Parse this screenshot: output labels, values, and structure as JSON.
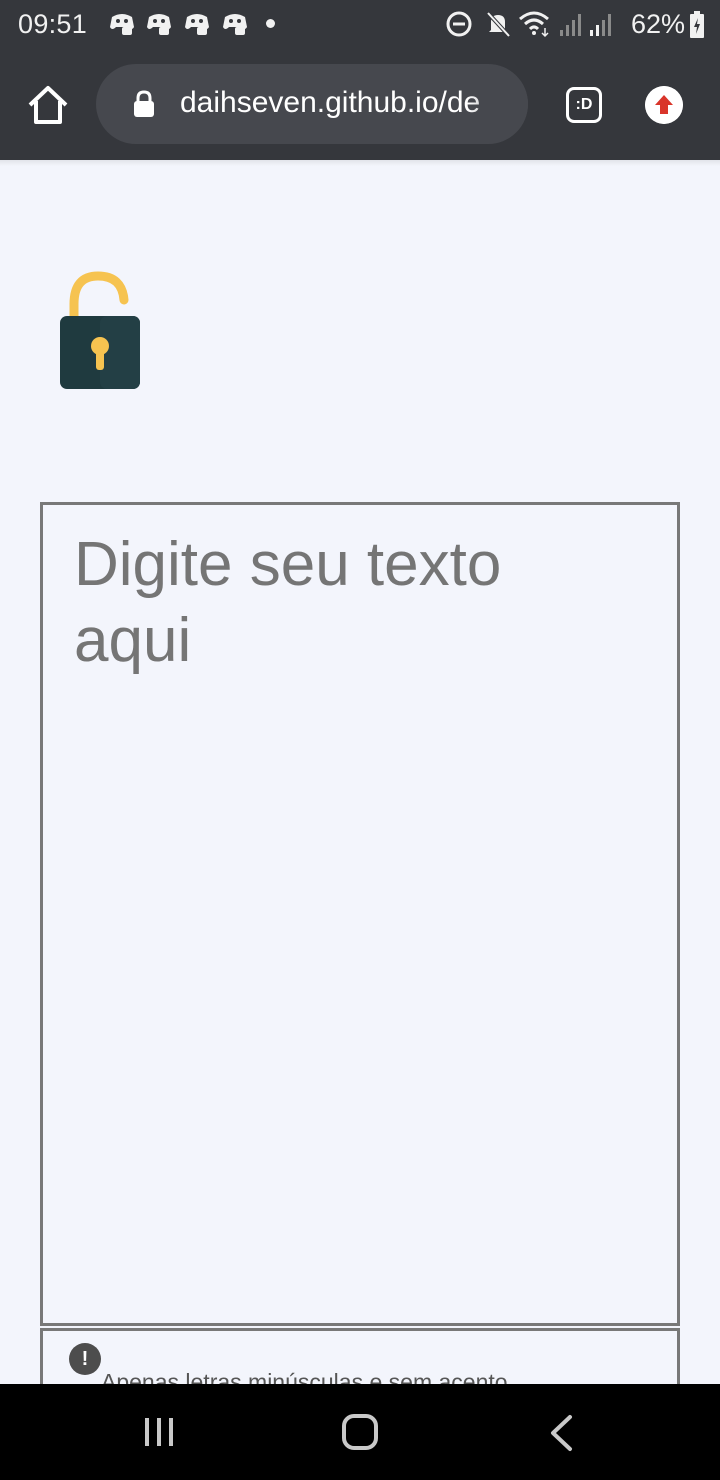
{
  "status_bar": {
    "time": "09:51",
    "battery": "62%",
    "notification_icons": [
      "game-notification-icon",
      "game-notification-icon",
      "game-notification-icon",
      "game-notification-icon"
    ],
    "system_icons": [
      "do-not-disturb-icon",
      "mute-icon",
      "wifi-icon",
      "signal-icon",
      "signal-icon",
      "battery-charging-icon"
    ]
  },
  "browser": {
    "url": "daihseven.github.io/de",
    "tab_label": ":D"
  },
  "page": {
    "textarea_placeholder": "Digite seu texto aqui",
    "hint": "Apenas letras minúsculas e sem acento",
    "hint_icon_glyph": "!"
  },
  "colors": {
    "toolbar": "#35373c",
    "page_background": "#f3f5fc",
    "lock_shackle": "#f6c350",
    "lock_body": "#1f3a3f",
    "upload_arrow": "#d9352a"
  }
}
